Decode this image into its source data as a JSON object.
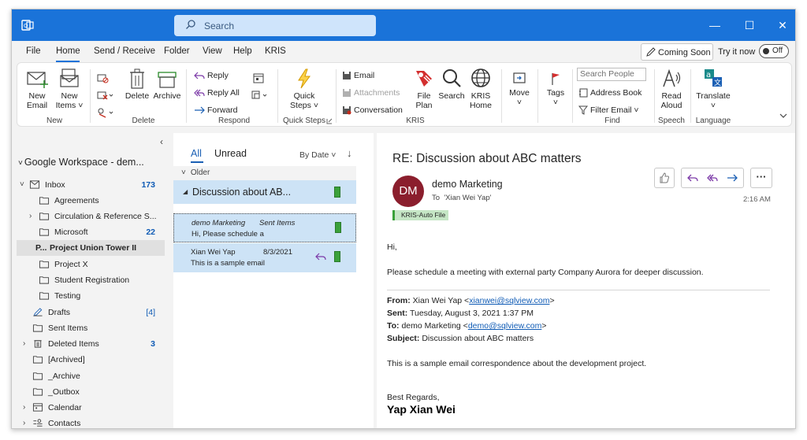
{
  "titlebar": {
    "search_placeholder": "Search",
    "minimize": "—",
    "maximize": "☐",
    "close": "✕"
  },
  "menu": {
    "items": [
      "File",
      "Home",
      "Send / Receive",
      "Folder",
      "View",
      "Help",
      "KRIS"
    ],
    "active": "Home",
    "coming_soon": "Coming Soon",
    "try_now": "Try it now",
    "toggle": "Off"
  },
  "ribbon": {
    "new_group": {
      "new_email": "New\nEmail",
      "new_email_l1": "New",
      "new_email_l2": "Email",
      "new_items_l1": "New",
      "new_items_l2": "Items ˅",
      "label": "New"
    },
    "delete_group": {
      "delete": "Delete",
      "archive": "Archive",
      "label": "Delete"
    },
    "respond_group": {
      "reply": "Reply",
      "reply_all": "Reply All",
      "forward": "Forward",
      "label": "Respond"
    },
    "quick_steps": {
      "l1": "Quick",
      "l2": "Steps ˅",
      "label": "Quick Steps"
    },
    "kris_group": {
      "email": "Email",
      "attachments": "Attachments",
      "conversation": "Conversation",
      "file_plan_l1": "File",
      "file_plan_l2": "Plan",
      "search": "Search",
      "kris_home_l1": "KRIS",
      "kris_home_l2": "Home",
      "label": "KRIS"
    },
    "move": {
      "label": "Move",
      "chev": "˅"
    },
    "tags": {
      "label": "Tags",
      "chev": "˅"
    },
    "find_group": {
      "search_people": "Search People",
      "address_book": "Address Book",
      "filter_email": "Filter Email ˅",
      "label": "Find"
    },
    "speech_group": {
      "l1": "Read",
      "l2": "Aloud",
      "label": "Speech"
    },
    "language_group": {
      "translate": "Translate",
      "chev": "˅",
      "label": "Language"
    }
  },
  "folders": {
    "account": "Google Workspace - dem...",
    "items": [
      {
        "label": "Inbox",
        "count": "173"
      },
      {
        "label": "Agreements",
        "count": ""
      },
      {
        "label": "Circulation & Reference S...",
        "count": ""
      },
      {
        "label": "Microsoft",
        "count": "22"
      },
      {
        "label": "Project Union Tower II",
        "count": "",
        "prefix": "P..."
      },
      {
        "label": "Project X",
        "count": ""
      },
      {
        "label": "Student Registration",
        "count": ""
      },
      {
        "label": "Testing",
        "count": ""
      },
      {
        "label": "Drafts",
        "count": "[4]"
      },
      {
        "label": "Sent Items",
        "count": ""
      },
      {
        "label": "Deleted Items",
        "count": "3"
      },
      {
        "label": "[Archived]",
        "count": ""
      },
      {
        "label": "_Archive",
        "count": ""
      },
      {
        "label": "_Outbox",
        "count": ""
      },
      {
        "label": "Calendar",
        "count": ""
      },
      {
        "label": "Contacts",
        "count": ""
      }
    ]
  },
  "list": {
    "tab_all": "All",
    "tab_unread": "Unread",
    "sort": "By Date ˅",
    "sort_arrow": "↓",
    "group": "Older",
    "conversation_title": "Discussion about AB...",
    "messages": [
      {
        "from": "demo Marketing",
        "folder": "Sent Items",
        "preview": "Hi,  Please schedule a",
        "date": ""
      },
      {
        "from": "Xian Wei Yap",
        "folder": "",
        "preview": "This is a sample email",
        "date": "8/3/2021"
      }
    ]
  },
  "reading": {
    "subject": "RE: Discussion about ABC matters",
    "avatar": "DM",
    "sender": "demo Marketing",
    "to_label": "To",
    "to_value": "'Xian Wei Yap'",
    "time": "2:16 AM",
    "category": "KRIS-Auto File",
    "more": "···",
    "greeting": "Hi,",
    "line1": "Please schedule a meeting with external party Company Aurora for deeper discussion.",
    "from_label": "From:",
    "from_name": " Xian Wei Yap <",
    "from_email": "xianwei@sqlview.com",
    "from_end": ">",
    "sent_label": "Sent:",
    "sent_value": " Tuesday, August 3, 2021 1:37 PM",
    "to2_label": "To:",
    "to2_name": " demo Marketing <",
    "to2_email": "demo@sqlview.com",
    "to2_end": ">",
    "subject_label": "Subject:",
    "subject_value": " Discussion about ABC matters",
    "line2": "This is a sample email correspondence about the development project.",
    "regards": "Best Regards,",
    "signature": "Yap Xian Wei"
  },
  "colors": {
    "titlebar": "#1a73d9",
    "accent": "#1a5fb4",
    "selection": "#cde3f6",
    "avatar": "#8b1e2d",
    "flag": "#3aa13a"
  }
}
